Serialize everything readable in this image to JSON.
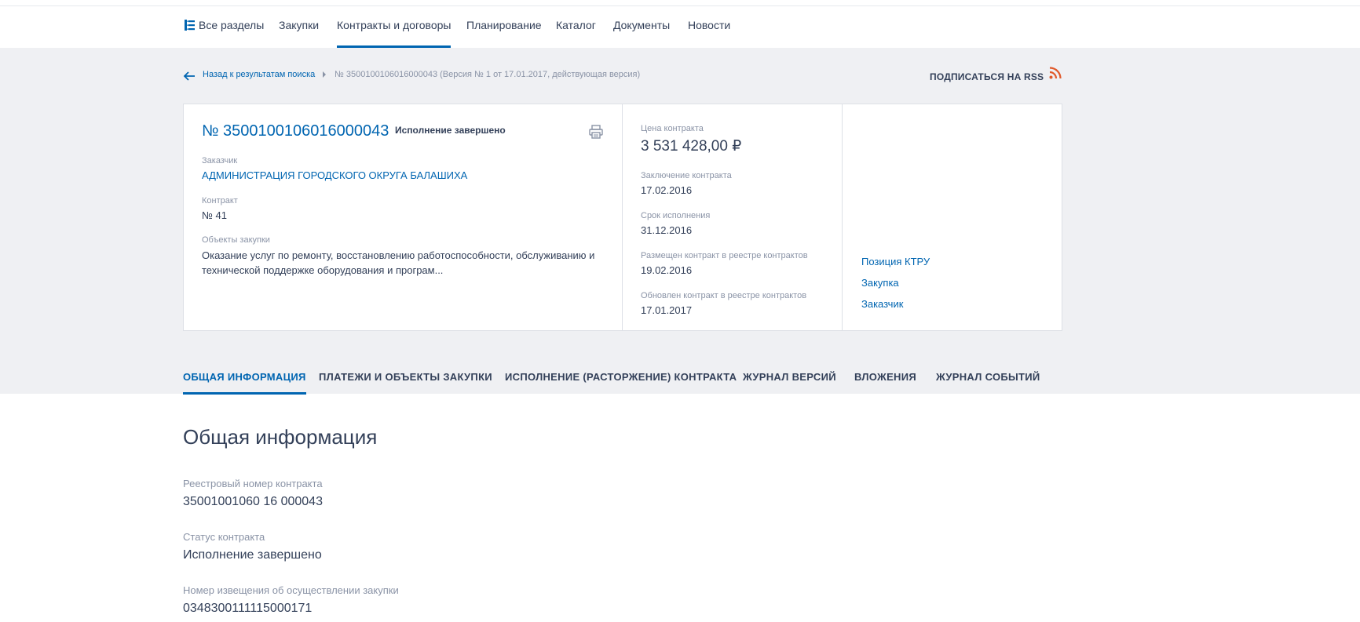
{
  "topnav": {
    "items": [
      "Все разделы",
      "Закупки",
      "Контракты и договоры",
      "Планирование",
      "Каталог",
      "Документы",
      "Новости"
    ]
  },
  "breadcrumb": {
    "back": "Назад к результатам поиска",
    "current": "№ 3500100106016000043 (Версия № 1 от 17.01.2017, действующая версия)"
  },
  "rss": {
    "label": "ПОДПИСАТЬСЯ НА RSS"
  },
  "card": {
    "number": "№ 3500100106016000043",
    "status": "Исполнение завершено",
    "customer_label": "Заказчик",
    "customer": "АДМИНИСТРАЦИЯ ГОРОДСКОГО ОКРУГА БАЛАШИХА",
    "contract_label": "Контракт",
    "contract": "№ 41",
    "objects_label": "Объекты закупки",
    "objects": "Оказание услуг по ремонту, восстановлению работоспособности, обслуживанию и технической поддержке оборудования и програм...",
    "price_label": "Цена контракта",
    "price": "3 531 428,00 ₽",
    "conclusion_label": "Заключение контракта",
    "conclusion": "17.02.2016",
    "term_label": "Срок исполнения",
    "term": "31.12.2016",
    "placed_label": "Размещен контракт в реестре контрактов",
    "placed": "19.02.2016",
    "updated_label": "Обновлен контракт в реестре контрактов",
    "updated": "17.01.2017",
    "links": [
      "Позиция КТРУ",
      "Закупка",
      "Заказчик"
    ]
  },
  "tabs": [
    "ОБЩАЯ ИНФОРМАЦИЯ",
    "ПЛАТЕЖИ И ОБЪЕКТЫ ЗАКУПКИ",
    "ИСПОЛНЕНИЕ (РАСТОРЖЕНИЕ) КОНТРАКТА",
    "ЖУРНАЛ ВЕРСИЙ",
    "ВЛОЖЕНИЯ",
    "ЖУРНАЛ СОБЫТИЙ"
  ],
  "general": {
    "title": "Общая информация",
    "reg_label": "Реестровый номер контракта",
    "reg_value": "35001001060 16 000043",
    "status_label": "Статус контракта",
    "status_value": "Исполнение завершено",
    "notice_label": "Номер извещения об осуществлении закупки",
    "notice_value": "0348300111115000171"
  },
  "colors": {
    "accent": "#0065b1",
    "band": "#eff0f3",
    "rss": "#e0592a",
    "text": "#334059",
    "muted": "#8a93a6"
  }
}
